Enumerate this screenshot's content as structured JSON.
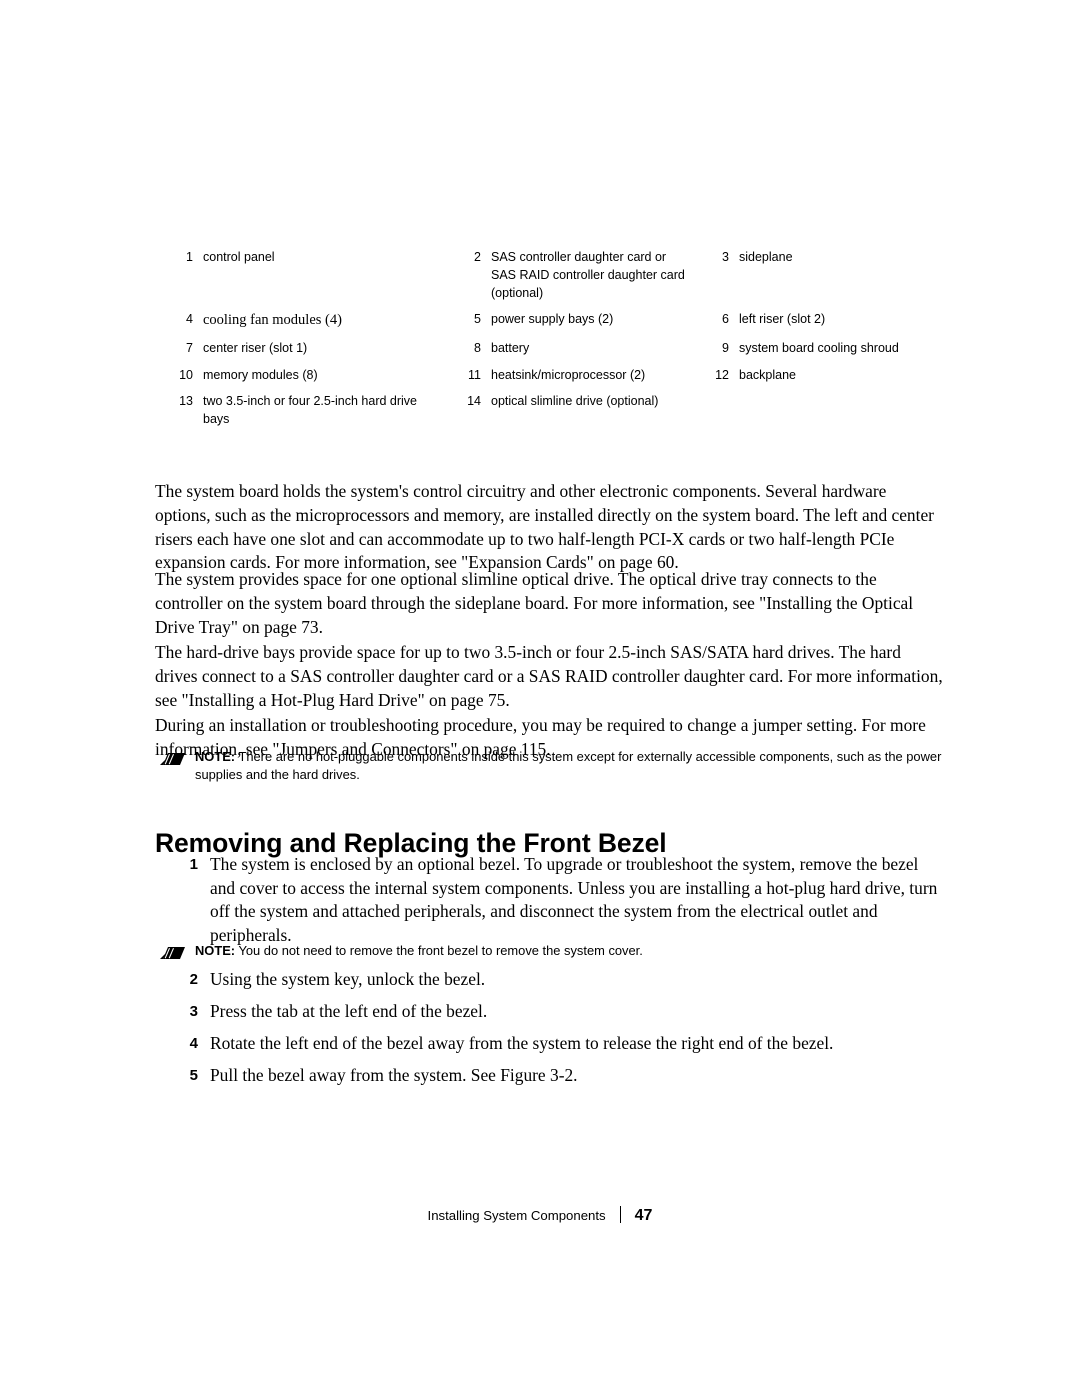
{
  "legend": {
    "rows": [
      [
        {
          "num": "1",
          "text": "control panel",
          "style": "sans"
        },
        {
          "num": "2",
          "text": "SAS controller daughter card or SAS RAID controller daughter card (optional)",
          "style": "sans"
        },
        {
          "num": "3",
          "text": "sideplane",
          "style": "sans"
        }
      ],
      [
        {
          "num": "4",
          "text": "cooling fan modules (4)",
          "style": "serif"
        },
        {
          "num": "5",
          "text": "power supply bays (2)",
          "style": "sans"
        },
        {
          "num": "6",
          "text": "left riser (slot 2)",
          "style": "sans"
        }
      ],
      [
        {
          "num": "7",
          "text": "center riser (slot 1)",
          "style": "sans"
        },
        {
          "num": "8",
          "text": "battery",
          "style": "sans"
        },
        {
          "num": "9",
          "text": "system board cooling shroud",
          "style": "sans"
        }
      ],
      [
        {
          "num": "10",
          "text": "memory modules (8)",
          "style": "sans"
        },
        {
          "num": "11",
          "text": "heatsink/microprocessor (2)",
          "style": "sans"
        },
        {
          "num": "12",
          "text": "backplane",
          "style": "sans"
        }
      ],
      [
        {
          "num": "13",
          "text": "two 3.5-inch or four 2.5-inch hard drive bays",
          "style": "sans"
        },
        {
          "num": "14",
          "text": "optical slimline drive (optional)",
          "style": "sans"
        },
        {
          "num": "",
          "text": "",
          "style": "sans"
        }
      ]
    ]
  },
  "body": {
    "p1": "The system board holds the system's control circuitry and other electronic components. Several hardware options, such as the microprocessors and memory, are installed directly on the system board. The left and center risers each have one slot and can accommodate up to two half-length PCI-X cards or two half-length PCIe expansion cards. For more information, see \"Expansion Cards\" on page 60.",
    "p2": "The system provides space for one optional slimline optical drive. The optical drive tray connects to the controller on the system board through the sideplane board. For more information, see \"Installing the Optical Drive Tray\" on page 73.",
    "p3": "The hard-drive bays provide space for up to two 3.5-inch or four 2.5-inch SAS/SATA hard drives. The hard drives connect to a SAS controller daughter card or a SAS RAID controller daughter card. For more information, see \"Installing a Hot-Plug Hard Drive\" on page 75.",
    "p4": "During an installation or troubleshooting procedure, you may be required to change a jumper setting. For more information, see \"Jumpers and Connectors\" on page 115."
  },
  "notes": {
    "note1_label": "NOTE:",
    "note1_text": " There are no hot-pluggable components inside this system except for externally accessible components, such as the power supplies and the hard drives.",
    "note2_label": "NOTE:",
    "note2_text": " You do not need to remove the front bezel to remove the system cover."
  },
  "heading": "Removing and Replacing the Front Bezel",
  "steps": [
    {
      "num": "1",
      "text": "The system is enclosed by an optional bezel. To upgrade or troubleshoot the system, remove the bezel and cover to access the internal system components. Unless you are installing a hot-plug hard drive, turn off the system and attached peripherals, and disconnect the system from the electrical outlet and peripherals."
    },
    {
      "num": "2",
      "text": "Using the system key, unlock the bezel."
    },
    {
      "num": "3",
      "text": "Press the tab at the left end of the bezel."
    },
    {
      "num": "4",
      "text": "Rotate the left end of the bezel away from the system to release the right end of the bezel."
    },
    {
      "num": "5",
      "text": "Pull the bezel away from the system. See Figure 3-2."
    }
  ],
  "footer": {
    "title": "Installing System Components",
    "page": "47"
  }
}
